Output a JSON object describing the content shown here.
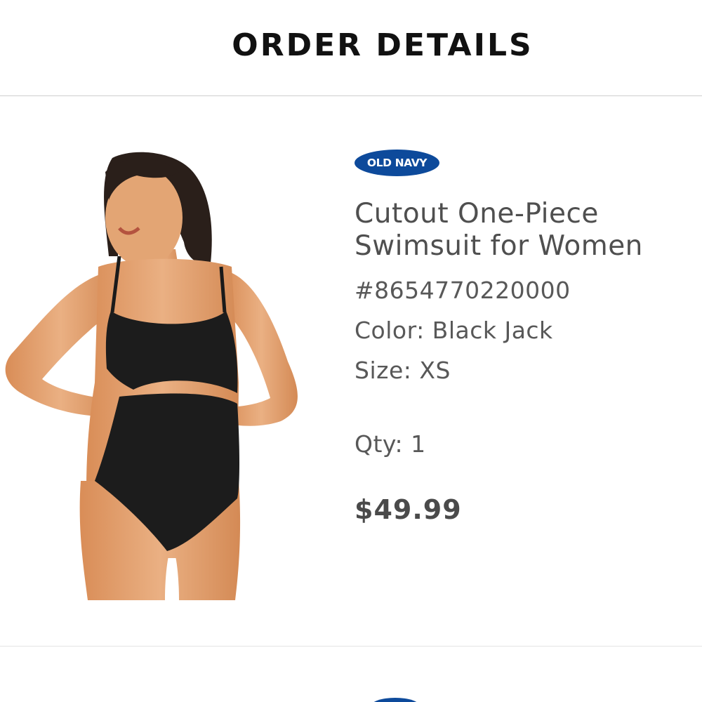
{
  "header": {
    "title": "ORDER DETAILS"
  },
  "item": {
    "brand": "OLD NAVY",
    "name_line1": "Cutout One-Piece",
    "name_line2": "Swimsuit for Women",
    "sku": "#8654770220000",
    "color": "Color: Black Jack",
    "size": "Size: XS",
    "qty": "Qty: 1",
    "price": "$49.99"
  },
  "colors": {
    "brand": "#0d4a9b",
    "swimsuit": "#1c1c1c",
    "skin": "#e2a070"
  },
  "icons": {
    "product_image": "swimsuit-photo"
  }
}
